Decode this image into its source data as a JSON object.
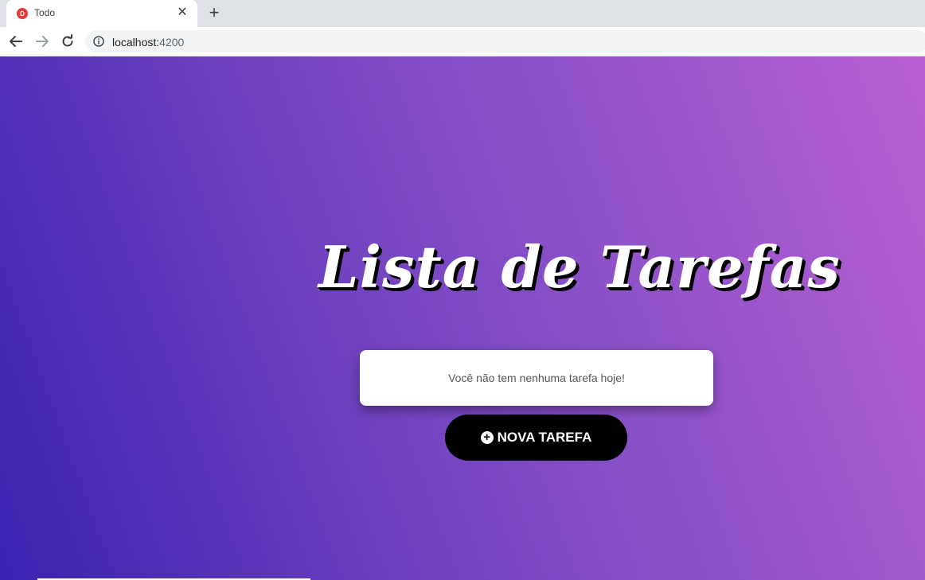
{
  "browser": {
    "tab": {
      "favicon_text": "D",
      "title": "Todo"
    },
    "url": {
      "host": "localhost:",
      "port": "4200"
    },
    "icons": [
      "back-arrow-icon",
      "forward-arrow-icon",
      "reload-icon",
      "info-icon",
      "close-icon",
      "plus-icon"
    ]
  },
  "app": {
    "title": "Lista de Tarefas",
    "empty_message": "Você não tem nenhuma tarefa hoje!",
    "new_task_label": "NOVA TAREFA",
    "colors": {
      "gradient_start": "#3a22b1",
      "gradient_end": "#b95fd2",
      "button_bg": "#000000",
      "card_bg": "#ffffff"
    }
  }
}
